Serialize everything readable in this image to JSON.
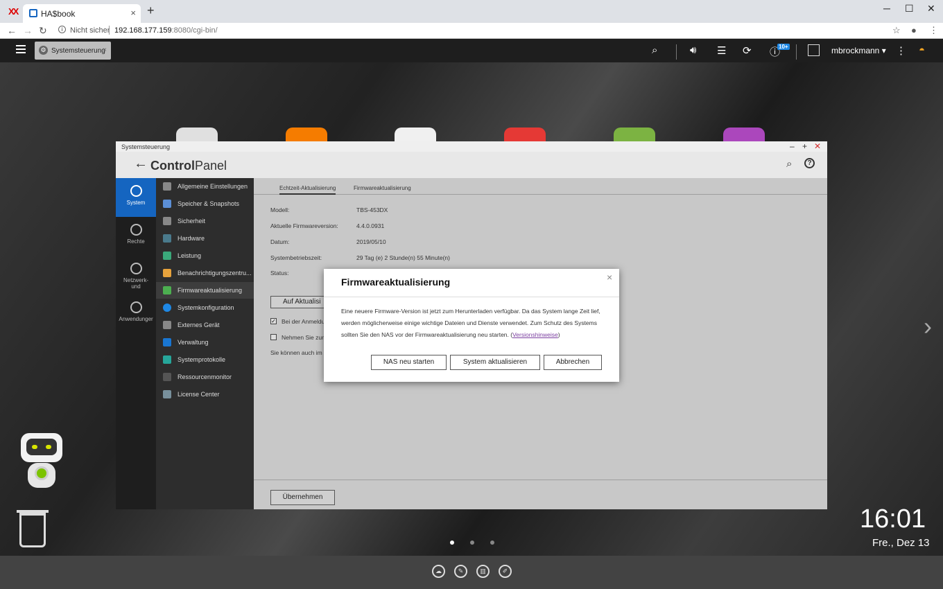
{
  "browser": {
    "tab_title": "HA$book",
    "tab_close": "×",
    "new_tab": "+",
    "controls": {
      "minimize": "─",
      "maximize": "☐",
      "close": "✕"
    },
    "security": "Nicht sicher",
    "url_host": "192.168.177.159",
    "url_rest": ":8080/cgi-bin/"
  },
  "qts": {
    "app_tab": "Systemsteuerung",
    "app_tab_close": "×",
    "notification_badge": "10+",
    "username": "mbrockmann ▾"
  },
  "window": {
    "title": "Systemsteuerung",
    "controls": {
      "minimize": "‒",
      "maximize": "+",
      "close": "✕"
    },
    "header_bold": "Control",
    "header_light": "Panel"
  },
  "left_nav": [
    {
      "label": "System"
    },
    {
      "label": "Rechte"
    },
    {
      "label": "Netzwerk-\nund"
    },
    {
      "label": "Anwendunger"
    }
  ],
  "menu": [
    {
      "label": "Allgemeine Einstellungen"
    },
    {
      "label": "Speicher & Snapshots"
    },
    {
      "label": "Sicherheit"
    },
    {
      "label": "Hardware"
    },
    {
      "label": "Leistung"
    },
    {
      "label": "Benachrichtigungszentru..."
    },
    {
      "label": "Firmwareaktualisierung"
    },
    {
      "label": "Systemkonfiguration"
    },
    {
      "label": "Externes Gerät"
    },
    {
      "label": "Verwaltung"
    },
    {
      "label": "Systemprotokolle"
    },
    {
      "label": "Ressourcenmonitor"
    },
    {
      "label": "License Center"
    }
  ],
  "tabs": [
    "Echtzeit-Aktualisierung",
    "Firmwareaktualisierung"
  ],
  "info": [
    {
      "label": "Modell:",
      "value": "TBS-453DX"
    },
    {
      "label": "Aktuelle Firmwareversion:",
      "value": "4.4.0.0931"
    },
    {
      "label": "Datum:",
      "value": "2019/05/10"
    },
    {
      "label": "Systembetriebszeit:",
      "value": "29 Tag (e) 2 Stunde(n) 55 Minute(n)"
    },
    {
      "label": "Status:",
      "value": ""
    }
  ],
  "check_button": "Auf Aktualisi",
  "checkbox1": "Bei der Anmeldu",
  "checkbox2": "Nehmen Sie zun",
  "note": "Sie können auch im",
  "apply_button": "Übernehmen",
  "dialog": {
    "title": "Firmwareaktualisierung",
    "close": "×",
    "body": "Eine neuere Firmware-Version ist jetzt zum Herunterladen verfügbar. Da das System lange Zeit lief, werden möglicherweise einige wichtige Dateien und Dienste verwendet. Zum Schutz des Systems sollten Sie den NAS vor der Firmwareaktualisierung neu starten. (",
    "link": "Versionshinweise",
    "body_end": ")",
    "buttons": {
      "restart": "NAS neu starten",
      "update": "System aktualisieren",
      "cancel": "Abbrechen"
    }
  },
  "clock": {
    "time": "16:01",
    "date": "Fre., Dez 13"
  }
}
